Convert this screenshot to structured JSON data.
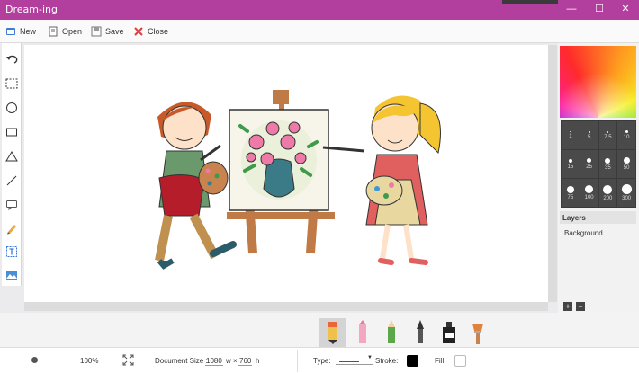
{
  "window": {
    "title": "Dream-ing",
    "minimize": "—",
    "maximize": "☐",
    "close": "✕"
  },
  "toolbar": {
    "new": "New",
    "open": "Open",
    "save": "Save",
    "close": "Close"
  },
  "tools": [
    "undo-icon",
    "rect-select-icon",
    "circle-icon",
    "rectangle-icon",
    "triangle-icon",
    "line-icon",
    "speech-bubble-icon",
    "pencil-icon",
    "text-box-icon",
    "image-icon"
  ],
  "brush_sizes": [
    {
      "label": "1"
    },
    {
      "label": "5"
    },
    {
      "label": "7.5"
    },
    {
      "label": "10"
    },
    {
      "label": "15"
    },
    {
      "label": "25"
    },
    {
      "label": "35"
    },
    {
      "label": "50"
    },
    {
      "label": "75"
    },
    {
      "label": "100"
    },
    {
      "label": "200"
    },
    {
      "label": "300"
    }
  ],
  "layers": {
    "header": "Layers",
    "items": [
      "Background"
    ],
    "add": "+",
    "remove": "−"
  },
  "brushes": [
    {
      "name": "marker",
      "color": "#e8663a",
      "active": true
    },
    {
      "name": "pink-pencil",
      "color": "#e87aa0",
      "active": false
    },
    {
      "name": "green-pencil",
      "color": "#5aa84a",
      "active": false
    },
    {
      "name": "ink-pen",
      "color": "#333333",
      "active": false
    },
    {
      "name": "ink-bottle",
      "color": "#222222",
      "active": false
    },
    {
      "name": "paint-brush",
      "color": "#e0823a",
      "active": false
    }
  ],
  "status": {
    "zoom": "100%",
    "doc_label": "Document Size :",
    "width": "1080",
    "times": "w ×",
    "height": "760",
    "h": "h",
    "type_label": "Type:",
    "stroke_label": "Stroke:",
    "fill_label": "Fill:",
    "stroke_color": "#000000",
    "fill_color": "#ffffff"
  },
  "colors": {
    "accent": "#b23f9d"
  }
}
